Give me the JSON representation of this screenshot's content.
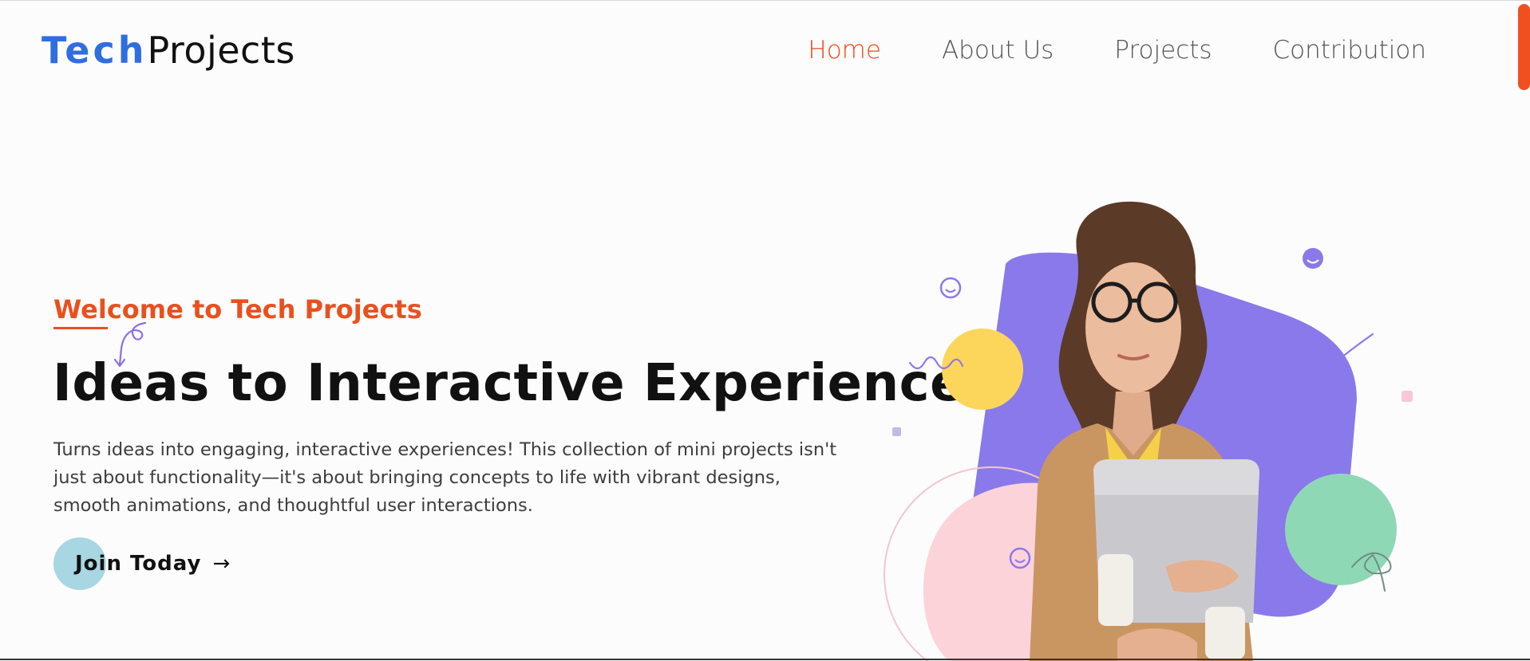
{
  "header": {
    "logo": {
      "part1": "Tech",
      "part2": "Projects"
    },
    "nav": [
      {
        "label": "Home",
        "active": true
      },
      {
        "label": "About Us",
        "active": false
      },
      {
        "label": "Projects",
        "active": false
      },
      {
        "label": "Contribution",
        "active": false
      }
    ]
  },
  "hero": {
    "welcome": "Welcome to Tech Projects",
    "title": "Ideas to Interactive Experience",
    "description": "Turns ideas into engaging, interactive experiences! This collection of mini projects isn't just about functionality—it's about bringing concepts to life with vibrant designs, smooth animations, and thoughtful user interactions.",
    "cta": {
      "label": "Join Today",
      "icon": "arrow-right-icon"
    }
  },
  "colors": {
    "accent": "#ee4a1c",
    "brand_blue": "#2f6ee0",
    "cta_circle": "#a8d6e3",
    "shape_purple": "#8a79ea",
    "shape_yellow": "#fcd65a",
    "shape_pink": "#fdd3da",
    "shape_green": "#8fd8b6"
  }
}
